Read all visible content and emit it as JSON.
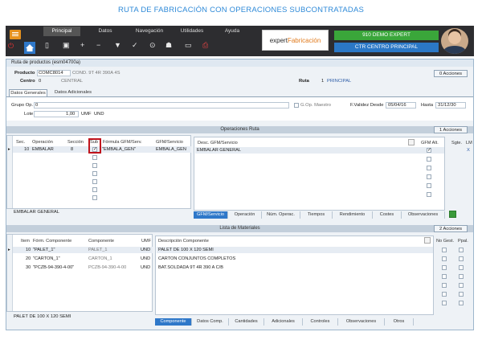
{
  "page_title": "RUTA DE FABRICACIÓN CON OPERACIONES SUBCONTRATADAS",
  "menu": {
    "tabs": [
      "Principal",
      "Datos",
      "Navegación",
      "Utilidades",
      "Ayuda"
    ]
  },
  "logo": {
    "prefix": "expert",
    "suffix": "Fabricación"
  },
  "company": "910 DEMO EXPERT",
  "center": "CTR CENTRO PRINCIPAL",
  "window_title": "Ruta de productos (esm04700a)",
  "header": {
    "producto_label": "Producto",
    "producto": "COMC8014",
    "producto_desc": "COND. 9T 4R 390A 4S",
    "centro_label": "Centro",
    "centro": "0",
    "centro_desc": "CENTRAL",
    "ruta_label": "Ruta",
    "ruta": "1",
    "ruta_desc": "PRINCIPAL",
    "acciones": "0  Acciones"
  },
  "tabs": [
    "Datos Generales",
    "Datos Adicionales"
  ],
  "general": {
    "grupo_label": "Grupo Op.",
    "grupo": "0",
    "gop_maestro": "G.Op. Maestro",
    "validez_label": "F.Validez Desde",
    "validez": "05/04/16",
    "hasta_label": "Hasta",
    "hasta": "31/12/30",
    "lote_label": "Lote",
    "lote": "1,00",
    "umf_label": "UMF",
    "umf": "UND"
  },
  "operaciones": {
    "title": "Operaciones Ruta",
    "acciones": "1  Acciones",
    "columns": [
      "Sec.",
      "Operación",
      "Sección",
      "Sub",
      "Fórmula GFM/Serv.",
      "GFM/Servicio"
    ],
    "rows": [
      {
        "sec": "10",
        "op": "EMBALAR",
        "seccion": "8",
        "formula": "\"EMBALA_GEN\"",
        "gfm": "EMBALA_GEN"
      }
    ],
    "footer": "EMBALAR GENERAL",
    "right_cols": [
      "Desc. GFM/Servicio",
      "GFM Alt.",
      "Sgte.",
      "LM"
    ],
    "right_rows": [
      {
        "desc": "EMBALAR GENERAL",
        "lm": "X"
      }
    ],
    "bottom_tabs": [
      "GFM/Servicio",
      "Operación",
      "Núm. Operac.",
      "Tiempos",
      "Rendimiento",
      "Costes",
      "Observaciones"
    ]
  },
  "materiales": {
    "title": "Lista de Materiales",
    "acciones": "2  Acciones",
    "columns": [
      "Item",
      "Fórm. Componente",
      "Componente",
      "UMF"
    ],
    "rows": [
      {
        "item": "10",
        "formula": "\"PALET_1\"",
        "comp": "PALET_1",
        "umf": "UND"
      },
      {
        "item": "20",
        "formula": "\"CARTON_1\"",
        "comp": "CARTON_1",
        "umf": "UND"
      },
      {
        "item": "30",
        "formula": "\"PCZB-94-390-4-00\"",
        "comp": "PCZB-94-390-4-00",
        "umf": "UND"
      }
    ],
    "footer": "PALET DE 100 X 120 SEMI",
    "right_cols": [
      "Descripción Componente",
      "No Gest.",
      "Ppal."
    ],
    "right_rows": [
      "PALET DE 100 X 120 SEMI",
      "CARTON CONJUNTOS COMPLETOS",
      "BAT.SOLDADA 9T 4R 390 A C/B"
    ],
    "bottom_tabs": [
      "Componente",
      "Datos Comp.",
      "Cantidades",
      "Adicionales",
      "Controles",
      "Observaciones",
      "Otros"
    ]
  }
}
